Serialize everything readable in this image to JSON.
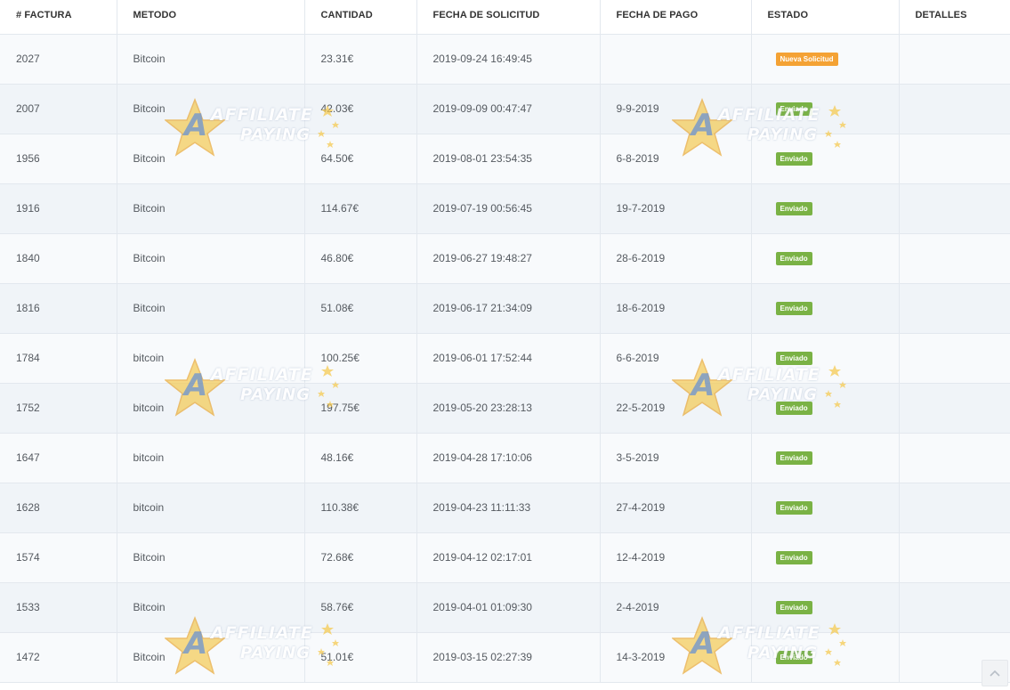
{
  "table": {
    "headers": [
      "# FACTURA",
      "METODO",
      "CANTIDAD",
      "FECHA DE SOLICITUD",
      "FECHA DE PAGO",
      "ESTADO",
      "DETALLES"
    ],
    "rows": [
      {
        "factura": "2027",
        "metodo": "Bitcoin",
        "cantidad": "23.31€",
        "fecha_solicitud": "2019-09-24 16:49:45",
        "fecha_pago": "",
        "estado": "Nueva Solicitud",
        "estado_type": "new",
        "detalles": ""
      },
      {
        "factura": "2007",
        "metodo": "Bitcoin",
        "cantidad": "42.03€",
        "fecha_solicitud": "2019-09-09 00:47:47",
        "fecha_pago": "9-9-2019",
        "estado": "Enviado",
        "estado_type": "sent",
        "detalles": ""
      },
      {
        "factura": "1956",
        "metodo": "Bitcoin",
        "cantidad": "64.50€",
        "fecha_solicitud": "2019-08-01 23:54:35",
        "fecha_pago": "6-8-2019",
        "estado": "Enviado",
        "estado_type": "sent",
        "detalles": ""
      },
      {
        "factura": "1916",
        "metodo": "Bitcoin",
        "cantidad": "114.67€",
        "fecha_solicitud": "2019-07-19 00:56:45",
        "fecha_pago": "19-7-2019",
        "estado": "Enviado",
        "estado_type": "sent",
        "detalles": ""
      },
      {
        "factura": "1840",
        "metodo": "Bitcoin",
        "cantidad": "46.80€",
        "fecha_solicitud": "2019-06-27 19:48:27",
        "fecha_pago": "28-6-2019",
        "estado": "Enviado",
        "estado_type": "sent",
        "detalles": ""
      },
      {
        "factura": "1816",
        "metodo": "Bitcoin",
        "cantidad": "51.08€",
        "fecha_solicitud": "2019-06-17 21:34:09",
        "fecha_pago": "18-6-2019",
        "estado": "Enviado",
        "estado_type": "sent",
        "detalles": ""
      },
      {
        "factura": "1784",
        "metodo": "bitcoin",
        "cantidad": "100.25€",
        "fecha_solicitud": "2019-06-01 17:52:44",
        "fecha_pago": "6-6-2019",
        "estado": "Enviado",
        "estado_type": "sent",
        "detalles": ""
      },
      {
        "factura": "1752",
        "metodo": "bitcoin",
        "cantidad": "197.75€",
        "fecha_solicitud": "2019-05-20 23:28:13",
        "fecha_pago": "22-5-2019",
        "estado": "Enviado",
        "estado_type": "sent",
        "detalles": ""
      },
      {
        "factura": "1647",
        "metodo": "bitcoin",
        "cantidad": "48.16€",
        "fecha_solicitud": "2019-04-28 17:10:06",
        "fecha_pago": "3-5-2019",
        "estado": "Enviado",
        "estado_type": "sent",
        "detalles": ""
      },
      {
        "factura": "1628",
        "metodo": "bitcoin",
        "cantidad": "110.38€",
        "fecha_solicitud": "2019-04-23 11:11:33",
        "fecha_pago": "27-4-2019",
        "estado": "Enviado",
        "estado_type": "sent",
        "detalles": ""
      },
      {
        "factura": "1574",
        "metodo": "Bitcoin",
        "cantidad": "72.68€",
        "fecha_solicitud": "2019-04-12 02:17:01",
        "fecha_pago": "12-4-2019",
        "estado": "Enviado",
        "estado_type": "sent",
        "detalles": ""
      },
      {
        "factura": "1533",
        "metodo": "Bitcoin",
        "cantidad": "58.76€",
        "fecha_solicitud": "2019-04-01 01:09:30",
        "fecha_pago": "2-4-2019",
        "estado": "Enviado",
        "estado_type": "sent",
        "detalles": ""
      },
      {
        "factura": "1472",
        "metodo": "Bitcoin",
        "cantidad": "51.01€",
        "fecha_solicitud": "2019-03-15 02:27:39",
        "fecha_pago": "14-3-2019",
        "estado": "Enviado",
        "estado_type": "sent",
        "detalles": ""
      }
    ]
  },
  "watermark": {
    "top_text": "AFFILIATE",
    "bottom_text": "PAYING",
    "logo_icon": "star-logo-icon"
  },
  "scroll_top_icon": "chevron-up-icon",
  "colors": {
    "enviado_badge": "#7ab245",
    "nueva_badge": "#f4a234",
    "row_odd": "#f8fafc",
    "row_even": "#f0f4f8",
    "border": "#e3e8ee"
  }
}
